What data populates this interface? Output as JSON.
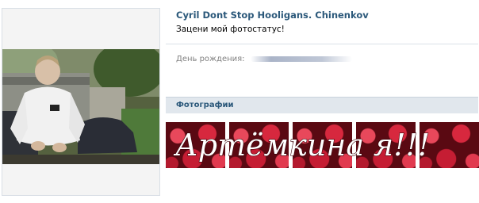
{
  "profile": {
    "name": "Cyril Dont Stop Hooligans. Chinenkov",
    "status": "Зацени мой фотостатус!",
    "avatar_icon": "profile-photo"
  },
  "info": {
    "birthday_label": "День рождения:",
    "birthday_value": ""
  },
  "photos": {
    "title": "Фотографии",
    "overlay_text": "Артёмкина я!!!",
    "thumbnails": [
      "thumb-1",
      "thumb-2",
      "thumb-3",
      "thumb-4",
      "thumb-5"
    ]
  },
  "colors": {
    "link": "#2b587a",
    "header_bg": "#e1e7ed",
    "separator": "#dae1e8"
  }
}
